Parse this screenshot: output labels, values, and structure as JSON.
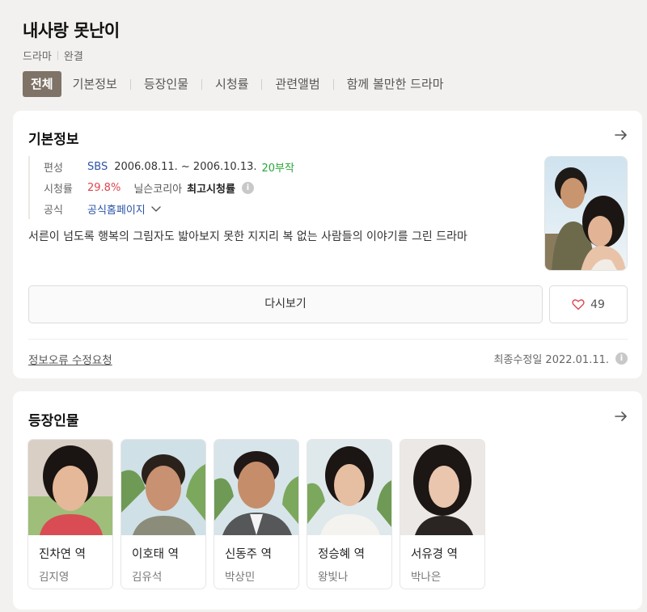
{
  "header": {
    "title": "내사랑 못난이",
    "genre": "드라마",
    "status": "완결",
    "tabs": [
      {
        "label": "전체",
        "active": true
      },
      {
        "label": "기본정보",
        "active": false
      },
      {
        "label": "등장인물",
        "active": false
      },
      {
        "label": "시청률",
        "active": false
      },
      {
        "label": "관련앨범",
        "active": false
      },
      {
        "label": "함께 볼만한 드라마",
        "active": false
      }
    ]
  },
  "basic_info": {
    "heading": "기본정보",
    "arrow_icon": "arrow-right-icon",
    "broadcast_label": "편성",
    "channel": "SBS",
    "period": "2006.08.11. ~ 2006.10.13.",
    "episodes": "20부작",
    "rating_label": "시청률",
    "rating_value": "29.8%",
    "rating_source": "닐슨코리아",
    "rating_desc": "최고시청률",
    "official_label": "공식",
    "official_link": "공식홈페이지",
    "description": "서른이 넘도록 행복의 그림자도 밟아보지 못한 지지리 복 없는 사람들의 이야기를 그린 드라마",
    "rewatch_label": "다시보기",
    "likes": "49",
    "report_link": "정보오류 수정요청",
    "updated": "최종수정일 2022.01.11."
  },
  "cast": {
    "heading": "등장인물",
    "arrow_icon": "arrow-right-icon",
    "members": [
      {
        "role": "진차연 역",
        "actor": "김지영"
      },
      {
        "role": "이호태 역",
        "actor": "김유석"
      },
      {
        "role": "신동주 역",
        "actor": "박상민"
      },
      {
        "role": "정승혜 역",
        "actor": "왕빛나"
      },
      {
        "role": "서유경 역",
        "actor": "박나은"
      }
    ]
  },
  "colors": {
    "page_bg": "#f3f1ef",
    "active_tab": "#7f7368",
    "link_blue": "#2a53a6",
    "episodes_green": "#27a83a",
    "rating_red": "#e0454f"
  }
}
